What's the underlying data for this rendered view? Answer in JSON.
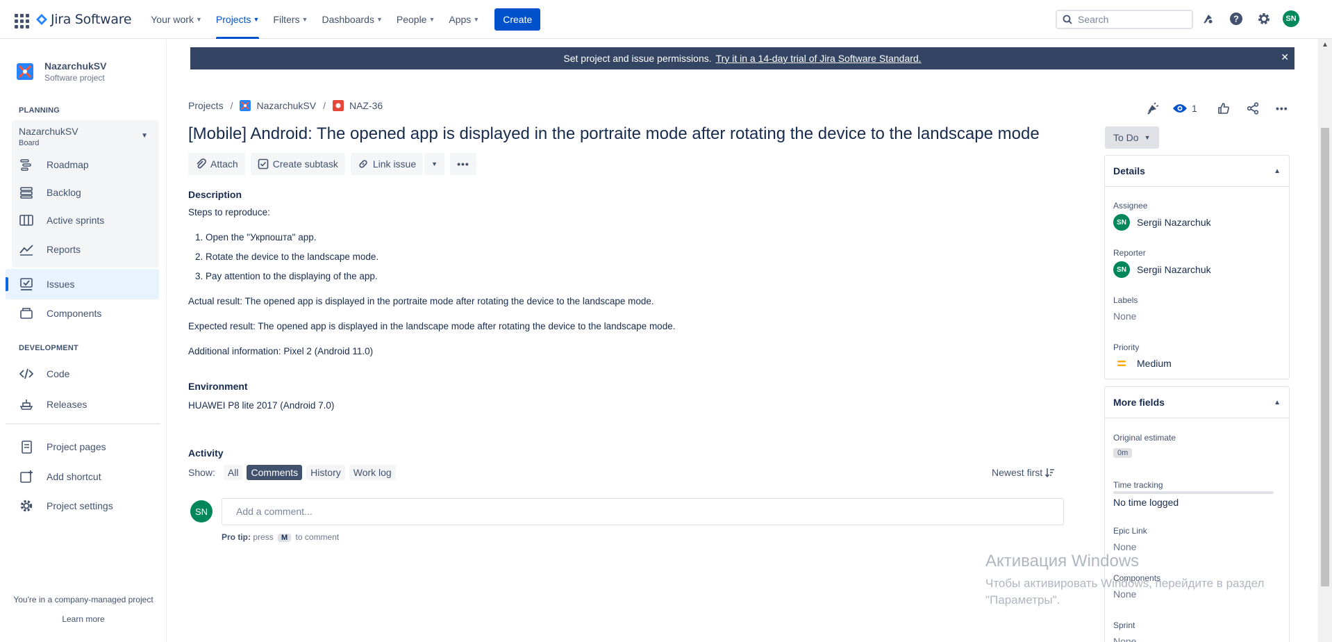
{
  "topnav": {
    "logo_text": "Jira Software",
    "items": [
      {
        "label": "Your work",
        "active": false
      },
      {
        "label": "Projects",
        "active": true
      },
      {
        "label": "Filters",
        "active": false
      },
      {
        "label": "Dashboards",
        "active": false
      },
      {
        "label": "People",
        "active": false
      },
      {
        "label": "Apps",
        "active": false
      }
    ],
    "create_label": "Create",
    "search_placeholder": "Search",
    "avatar_initials": "SN"
  },
  "sidebar": {
    "project_name": "NazarchukSV",
    "project_type": "Software project",
    "planning_title": "PLANNING",
    "board_name": "NazarchukSV",
    "board_sub": "Board",
    "planning_items": [
      "Roadmap",
      "Backlog",
      "Active sprints",
      "Reports"
    ],
    "issues_label": "Issues",
    "components_label": "Components",
    "development_title": "DEVELOPMENT",
    "code_label": "Code",
    "releases_label": "Releases",
    "project_pages_label": "Project pages",
    "add_shortcut_label": "Add shortcut",
    "project_settings_label": "Project settings",
    "company_note": "You're in a company-managed project",
    "learn_more": "Learn more"
  },
  "banner": {
    "text": "Set project and issue permissions.",
    "link": "Try it in a 14-day trial of Jira Software Standard."
  },
  "breadcrumb": {
    "projects": "Projects",
    "project": "NazarchukSV",
    "issue_key": "NAZ-36"
  },
  "issue": {
    "title": "[Mobile] Android: The opened app is displayed in the portraite mode after rotating the device to the landscape mode",
    "actions": {
      "attach": "Attach",
      "create_subtask": "Create subtask",
      "link_issue": "Link issue"
    },
    "description_heading": "Description",
    "steps_intro": "Steps to reproduce:",
    "steps": [
      "1. Open the \"Укрпошта\" app.",
      "2.  Rotate the device to the landscape mode.",
      "3. Pay attention to the displaying of the app."
    ],
    "actual_result": "Actual result: The opened app is displayed in the portraite mode after rotating the device to the landscape mode.",
    "expected_result": "Expected result: The opened app is displayed in the landscape mode after rotating the device to the landscape mode.",
    "additional_info": "Additional information: Pixel 2 (Android 11.0)",
    "environment_heading": "Environment",
    "environment": "HUAWEI P8 lite 2017 (Android 7.0)"
  },
  "activity": {
    "heading": "Activity",
    "show_label": "Show:",
    "filters": [
      {
        "label": "All",
        "selected": false
      },
      {
        "label": "Comments",
        "selected": true
      },
      {
        "label": "History",
        "selected": false
      },
      {
        "label": "Work log",
        "selected": false
      }
    ],
    "sort_label": "Newest first",
    "comment_avatar": "SN",
    "comment_placeholder": "Add a comment...",
    "protip_bold": "Pro tip:",
    "protip_pre": "press",
    "protip_key": "M",
    "protip_post": "to comment"
  },
  "header_right": {
    "watch_count": "1"
  },
  "status": {
    "label": "To Do"
  },
  "details": {
    "heading": "Details",
    "assignee_label": "Assignee",
    "assignee": "Sergii Nazarchuk",
    "assignee_initials": "SN",
    "reporter_label": "Reporter",
    "reporter": "Sergii Nazarchuk",
    "reporter_initials": "SN",
    "labels_label": "Labels",
    "labels_value": "None",
    "priority_label": "Priority",
    "priority_value": "Medium",
    "priority_color": "#ffab00"
  },
  "more_fields": {
    "heading": "More fields",
    "original_estimate_label": "Original estimate",
    "original_estimate_value": "0m",
    "time_tracking_label": "Time tracking",
    "time_tracking_value": "No time logged",
    "epic_link_label": "Epic Link",
    "epic_link_value": "None",
    "components_label": "Components",
    "components_value": "None",
    "sprint_label": "Sprint",
    "sprint_value": "None"
  },
  "watermark": {
    "line1": "Активация Windows",
    "line2": "Чтобы активировать Windows, перейдите в раздел",
    "line3": "\"Параметры\"."
  },
  "colors": {
    "brand": "#0052cc",
    "banner_bg": "#344563",
    "avatar_green": "#00875a"
  }
}
